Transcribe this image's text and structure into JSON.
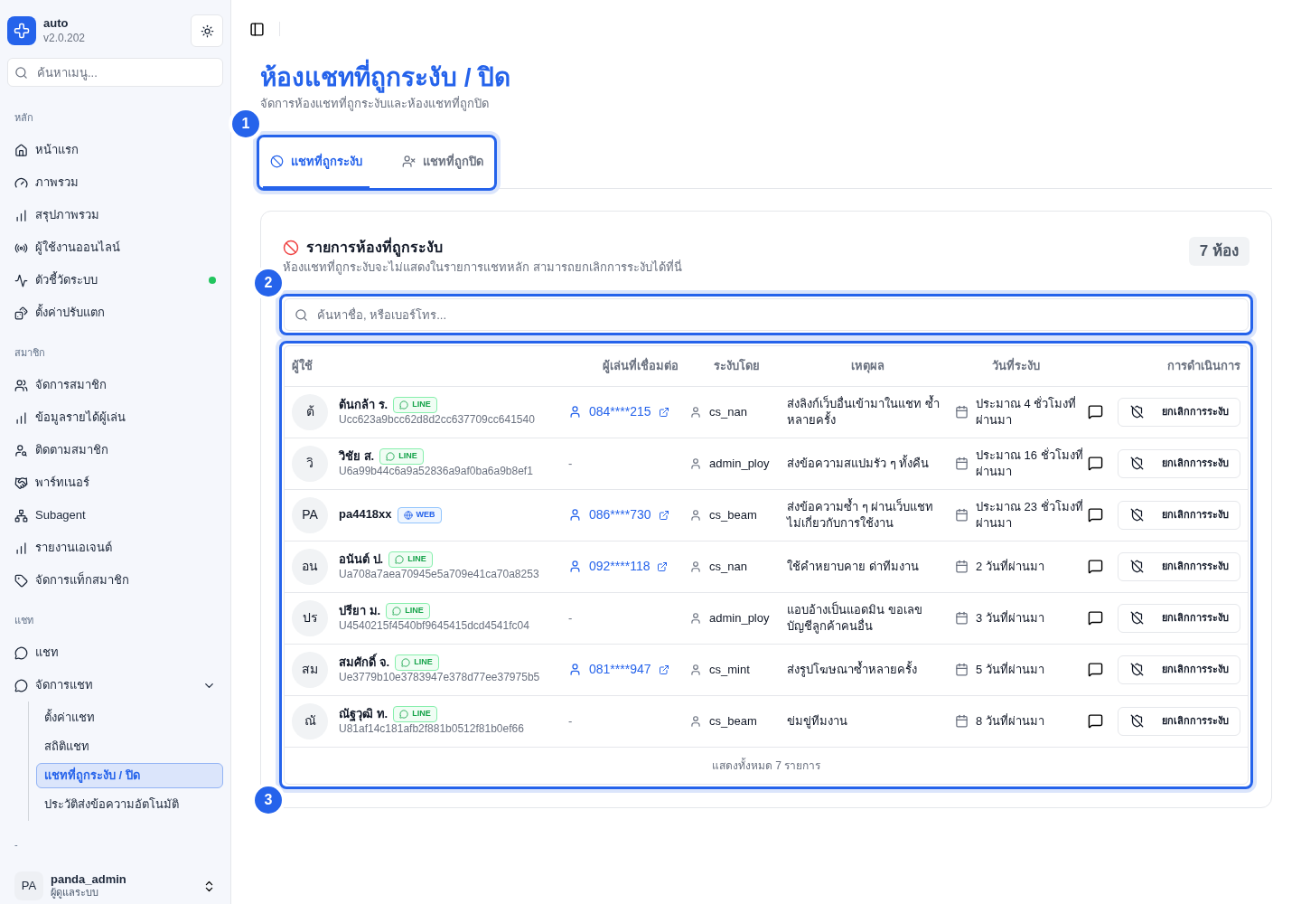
{
  "app": {
    "name": "auto",
    "version": "v2.0.202"
  },
  "sidebar": {
    "search": {
      "placeholder": "ค้นหาเมนู..."
    },
    "sections": [
      {
        "label": "หลัก",
        "items": [
          {
            "label": "หน้าแรก",
            "selected": false,
            "online": false
          },
          {
            "label": "ภาพรวม",
            "selected": false,
            "online": false
          },
          {
            "label": "สรุปภาพรวม",
            "selected": false,
            "online": false
          },
          {
            "label": "ผู้ใช้งานออนไลน์",
            "selected": false,
            "online": false
          },
          {
            "label": "ตัวชี้วัดระบบ",
            "selected": false,
            "online": true
          },
          {
            "label": "ตั้งค่าปรับแตก",
            "selected": false,
            "online": false
          }
        ]
      },
      {
        "label": "สมาชิก",
        "items": [
          {
            "label": "จัดการสมาชิก",
            "selected": false
          },
          {
            "label": "ข้อมูลรายได้ผู้เล่น",
            "selected": false
          },
          {
            "label": "ติดตามสมาชิก",
            "selected": false
          },
          {
            "label": "พาร์ทเนอร์",
            "selected": false
          },
          {
            "label": "Subagent",
            "selected": false
          },
          {
            "label": "รายงานเอเจนต์",
            "selected": false
          },
          {
            "label": "จัดการแท็กสมาชิก",
            "selected": false
          }
        ]
      },
      {
        "label": "แชท",
        "items": [
          {
            "label": "แชท",
            "selected": false
          },
          {
            "label": "จัดการแชท",
            "selected": false,
            "expanded": true,
            "children": [
              {
                "label": "ตั้งค่าแชท",
                "selected": false
              },
              {
                "label": "สถิติแชท",
                "selected": false
              },
              {
                "label": "แชทที่ถูกระงับ / ปิด",
                "selected": true
              },
              {
                "label": "ประวัติส่งข้อความอัตโนมัติ",
                "selected": false
              }
            ]
          }
        ]
      },
      {
        "label": "-"
      }
    ],
    "user": {
      "initials": "PA",
      "name": "panda_admin",
      "role": "ผู้ดูแลระบบ"
    }
  },
  "page": {
    "title": "ห้องแชทที่ถูกระงับ / ปิด",
    "subtitle": "จัดการห้องแชทที่ถูกระงับและห้องแชทที่ถูกปิด"
  },
  "tabs": {
    "callout": "1",
    "items": [
      {
        "label": "แชทที่ถูกระงับ",
        "selected": true
      },
      {
        "label": "แชทที่ถูกปิด",
        "selected": false
      }
    ]
  },
  "card": {
    "title": "รายการห้องที่ถูกระงับ",
    "description": "ห้องแชทที่ถูกระงับจะไม่แสดงในรายการแชทหลัก สามารถยกเลิกการระงับได้ที่นี่",
    "count": "7 ห้อง"
  },
  "search": {
    "callout": "2",
    "placeholder": "ค้นหาชื่อ, หรือเบอร์โทร..."
  },
  "table": {
    "callout": "3",
    "columns": [
      "ผู้ใช้",
      "ผู้เล่นที่เชื่อมต่อ",
      "ระงับโดย",
      "เหตุผล",
      "วันที่ระงับ",
      "การดำเนินการ"
    ],
    "rows": [
      {
        "initials": "ต้",
        "name": "ต้นกล้า ร.",
        "channel": {
          "kind": "line",
          "label": "LINE"
        },
        "uid": "Ucc623a9bcc62d8d2cc637709cc641540",
        "player": "084****215",
        "linked": true,
        "by": "cs_nan",
        "reason": "ส่งลิงก์เว็บอื่นเข้ามาในแชท ซ้ำหลายครั้ง",
        "date": "ประมาณ 4 ชั่วโมงที่ผ่านมา",
        "action": "ยกเลิกการระงับ"
      },
      {
        "initials": "วิ",
        "name": "วิชัย ส.",
        "channel": {
          "kind": "line",
          "label": "LINE"
        },
        "uid": "U6a99b44c6a9a52836a9af0ba6a9b8ef1",
        "player": "-",
        "linked": false,
        "by": "admin_ploy",
        "reason": "ส่งข้อความสแปมรัว ๆ ทั้งคืน",
        "date": "ประมาณ 16 ชั่วโมงที่ผ่านมา",
        "action": "ยกเลิกการระงับ"
      },
      {
        "initials": "PA",
        "name": "pa4418xx",
        "channel": {
          "kind": "web",
          "label": "WEB"
        },
        "player": "086****730",
        "linked": true,
        "by": "cs_beam",
        "reason": "ส่งข้อความซ้ำ ๆ ผ่านเว็บแชท ไม่เกี่ยวกับการใช้งาน",
        "date": "ประมาณ 23 ชั่วโมงที่ผ่านมา",
        "action": "ยกเลิกการระงับ"
      },
      {
        "initials": "อน",
        "name": "อนันต์ ป.",
        "channel": {
          "kind": "line",
          "label": "LINE"
        },
        "uid": "Ua708a7aea70945e5a709e41ca70a8253",
        "player": "092****118",
        "linked": true,
        "by": "cs_nan",
        "reason": "ใช้คำหยาบคาย ด่าทีมงาน",
        "date": "2 วันที่ผ่านมา",
        "action": "ยกเลิกการระงับ"
      },
      {
        "initials": "ปร",
        "name": "ปรียา ม.",
        "channel": {
          "kind": "line",
          "label": "LINE"
        },
        "uid": "U4540215f4540bf9645415dcd4541fc04",
        "player": "-",
        "linked": false,
        "by": "admin_ploy",
        "reason": "แอบอ้างเป็นแอดมิน ขอเลขบัญชีลูกค้าคนอื่น",
        "date": "3 วันที่ผ่านมา",
        "action": "ยกเลิกการระงับ"
      },
      {
        "initials": "สม",
        "name": "สมศักดิ์ จ.",
        "channel": {
          "kind": "line",
          "label": "LINE"
        },
        "uid": "Ue3779b10e3783947e378d77ee37975b5",
        "player": "081****947",
        "linked": true,
        "by": "cs_mint",
        "reason": "ส่งรูปโฆษณาซ้ำหลายครั้ง",
        "date": "5 วันที่ผ่านมา",
        "action": "ยกเลิกการระงับ"
      },
      {
        "initials": "ณั",
        "name": "ณัฐวุฒิ ท.",
        "channel": {
          "kind": "line",
          "label": "LINE"
        },
        "uid": "U81af14c181afb2f881b0512f81b0ef66",
        "player": "-",
        "linked": false,
        "by": "cs_beam",
        "reason": "ข่มขู่ทีมงาน",
        "date": "8 วันที่ผ่านมา",
        "action": "ยกเลิกการระงับ"
      }
    ],
    "footer": "แสดงทั้งหมด 7 รายการ"
  }
}
